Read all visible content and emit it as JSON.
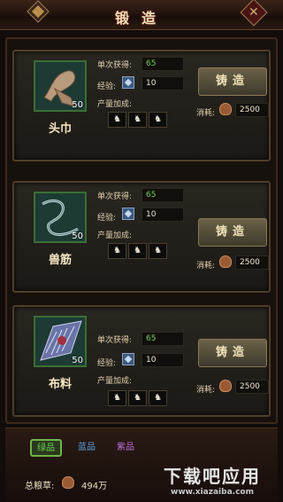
{
  "header": {
    "title": "锻造"
  },
  "labels": {
    "single_gain": "单次获得:",
    "exp": "经验:",
    "yield_bonus": "产量加成:",
    "cost": "消耗:",
    "forge_button": "铸造"
  },
  "items": [
    {
      "name": "头巾",
      "count": "50",
      "single_gain_value": "65",
      "exp_value": "10",
      "cost_value": "2500",
      "bonus_slots": [
        "♞",
        "♞",
        "♞"
      ],
      "icon": "headscarf-icon"
    },
    {
      "name": "兽筋",
      "count": "50",
      "single_gain_value": "65",
      "exp_value": "10",
      "cost_value": "2500",
      "bonus_slots": [
        "♞",
        "♞",
        "♞"
      ],
      "icon": "tendon-icon"
    },
    {
      "name": "布料",
      "count": "50",
      "single_gain_value": "65",
      "exp_value": "10",
      "cost_value": "2500",
      "bonus_slots": [
        "♞",
        "♞",
        "♞"
      ],
      "icon": "cloth-icon"
    }
  ],
  "filters": {
    "tabs": [
      {
        "label": "绿品",
        "color": "#6ad055"
      },
      {
        "label": "蓝品",
        "color": "#5a9ee0"
      },
      {
        "label": "紫品",
        "color": "#c070e0"
      }
    ],
    "total_grain_label": "总粮草:",
    "total_grain_value": "494万"
  },
  "watermark": {
    "main": "下载吧应用",
    "url": "www.xiazaiba.com"
  },
  "colors": {
    "accent_green": "#6ad055",
    "frame_gold": "#8a6a3a",
    "title_red": "#7a1010"
  }
}
